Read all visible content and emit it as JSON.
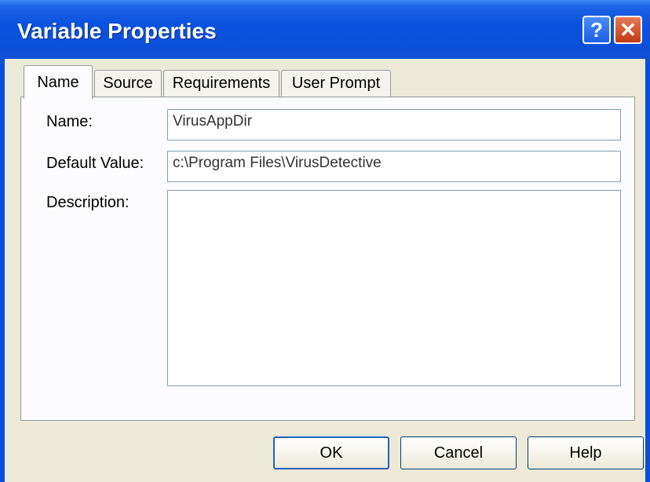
{
  "window": {
    "title": "Variable Properties",
    "help_glyph": "?",
    "close_glyph": "✕"
  },
  "tabs": [
    {
      "label": "Name",
      "active": true
    },
    {
      "label": "Source",
      "active": false
    },
    {
      "label": "Requirements",
      "active": false
    },
    {
      "label": "User Prompt",
      "active": false
    }
  ],
  "form": {
    "name_label": "Name:",
    "name_value": "VirusAppDir",
    "default_label": "Default Value:",
    "default_value": "c:\\Program Files\\VirusDetective",
    "description_label": "Description:",
    "description_value": ""
  },
  "buttons": {
    "ok": "OK",
    "cancel": "Cancel",
    "help": "Help"
  },
  "colors": {
    "title_bar": "#0b4fd8",
    "dialog_bg": "#ece9d8",
    "close_button": "#c23a14"
  }
}
